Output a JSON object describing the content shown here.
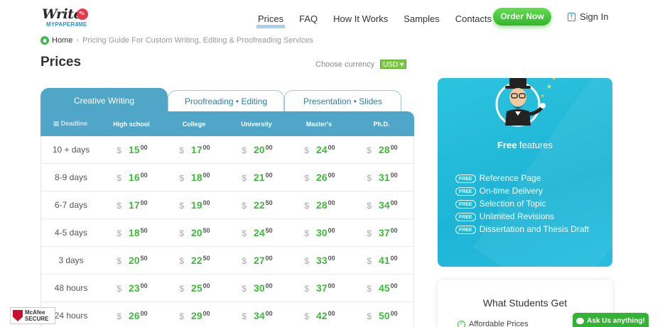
{
  "header": {
    "logo_text": "Write",
    "logo_sub": "MYPAPER4ME",
    "nav": [
      {
        "label": "Prices",
        "active": true
      },
      {
        "label": "FAQ"
      },
      {
        "label": "How It Works"
      },
      {
        "label": "Samples"
      },
      {
        "label": "Contacts"
      }
    ],
    "order_label": "Order Now",
    "signin_label": "Sign In"
  },
  "breadcrumb": {
    "home": "Home",
    "current": "Pricing Guide For Custom Writing, Editing & Proofreading Services"
  },
  "page_title": "Prices",
  "currency": {
    "label": "Choose currency",
    "value": "USD"
  },
  "tabs": [
    "Creative Writing",
    "Proofreading • Editing",
    "Presentation • Slides"
  ],
  "table": {
    "headers": [
      "Deadline",
      "High school",
      "College",
      "University",
      "Master's",
      "Ph.D."
    ],
    "currency_symbol": "$",
    "rows": [
      {
        "deadline": "10 + days",
        "prices": [
          [
            "15",
            "00"
          ],
          [
            "17",
            "00"
          ],
          [
            "20",
            "00"
          ],
          [
            "24",
            "00"
          ],
          [
            "28",
            "00"
          ]
        ]
      },
      {
        "deadline": "8-9 days",
        "prices": [
          [
            "16",
            "00"
          ],
          [
            "18",
            "00"
          ],
          [
            "21",
            "00"
          ],
          [
            "26",
            "00"
          ],
          [
            "31",
            "00"
          ]
        ]
      },
      {
        "deadline": "6-7 days",
        "prices": [
          [
            "17",
            "00"
          ],
          [
            "19",
            "00"
          ],
          [
            "22",
            "50"
          ],
          [
            "28",
            "00"
          ],
          [
            "34",
            "00"
          ]
        ]
      },
      {
        "deadline": "4-5 days",
        "prices": [
          [
            "18",
            "50"
          ],
          [
            "20",
            "50"
          ],
          [
            "24",
            "50"
          ],
          [
            "30",
            "00"
          ],
          [
            "37",
            "00"
          ]
        ]
      },
      {
        "deadline": "3 days",
        "prices": [
          [
            "20",
            "50"
          ],
          [
            "22",
            "50"
          ],
          [
            "27",
            "00"
          ],
          [
            "33",
            "00"
          ],
          [
            "41",
            "00"
          ]
        ]
      },
      {
        "deadline": "48 hours",
        "prices": [
          [
            "23",
            "00"
          ],
          [
            "25",
            "00"
          ],
          [
            "30",
            "00"
          ],
          [
            "37",
            "00"
          ],
          [
            "45",
            "00"
          ]
        ]
      },
      {
        "deadline": "24 hours",
        "prices": [
          [
            "26",
            "00"
          ],
          [
            "29",
            "00"
          ],
          [
            "34",
            "00"
          ],
          [
            "42",
            "00"
          ],
          [
            "50",
            "00"
          ]
        ]
      }
    ]
  },
  "free_features": {
    "title_bold": "Free",
    "title_rest": " features",
    "badge": "FREE",
    "items": [
      "Reference Page",
      "On-time Delivery",
      "Selection of Topic",
      "Unlimited Revisions",
      "Dissertation and Thesis Draft"
    ]
  },
  "students": {
    "title": "What Students Get",
    "first_item": "Affordable Prices"
  },
  "mcafee": {
    "line1": "McAfee",
    "line2": "SECURE"
  },
  "chat_label": "Ask Us anything!",
  "colors": {
    "accent_blue": "#50a6c8",
    "price_green": "#3fba3a",
    "order_green": "#34b233",
    "card_cyan": "#1eb4d5"
  }
}
